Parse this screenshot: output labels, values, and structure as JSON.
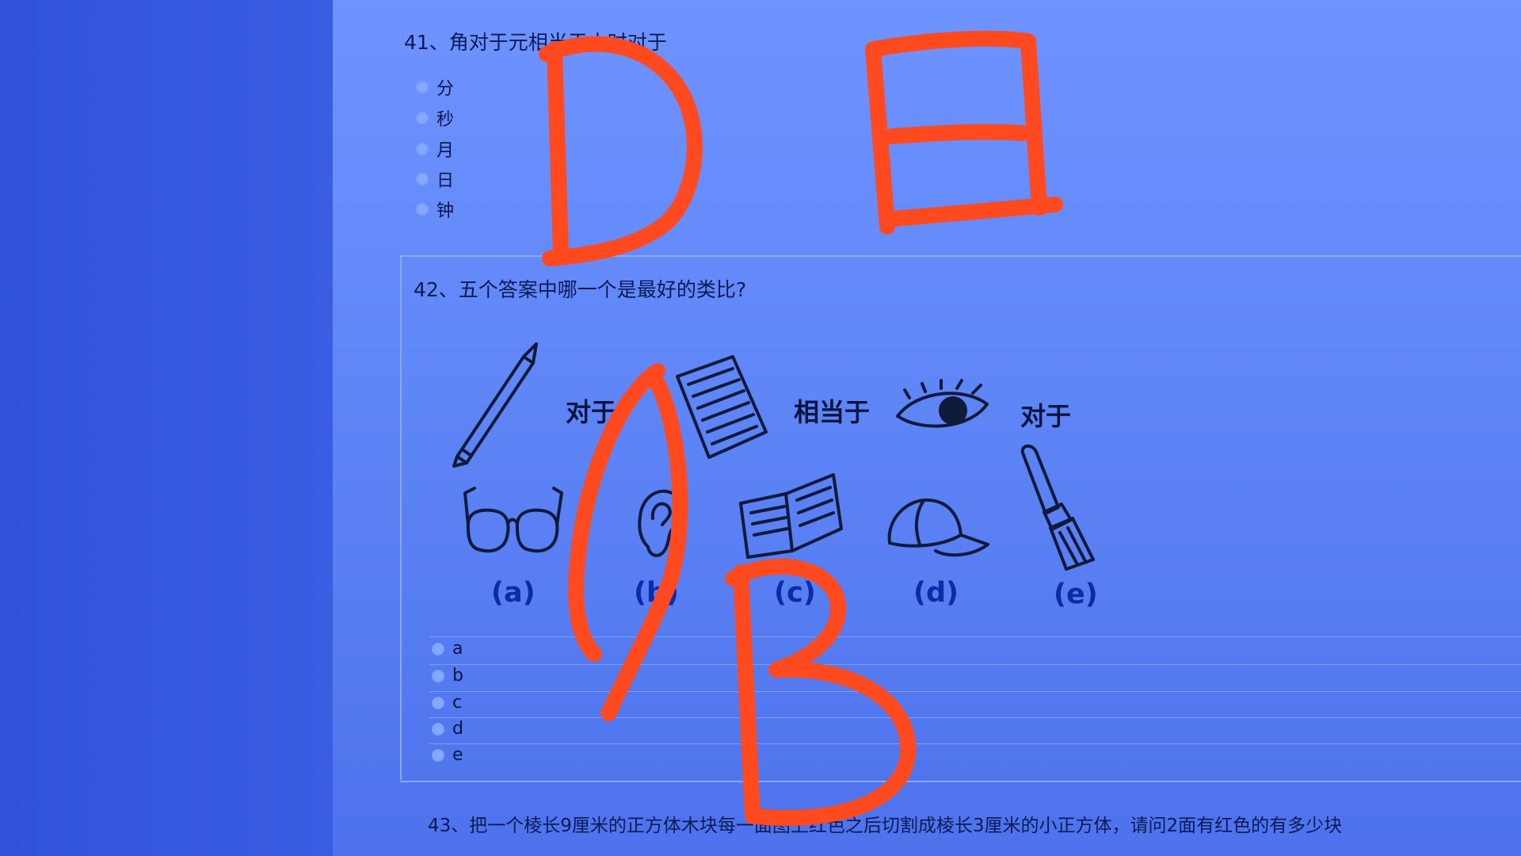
{
  "q41": {
    "title": "41、角对于元相当于小时对于",
    "options": [
      "分",
      "秒",
      "月",
      "日",
      "钟"
    ]
  },
  "q42": {
    "title": "42、五个答案中哪一个是最好的类比?",
    "words": {
      "w1": "对于",
      "w2": "相当于",
      "w3": "对于"
    },
    "figure_labels": [
      "(a)",
      "(b)",
      "(c)",
      "(d)",
      "(e)"
    ],
    "options": [
      "a",
      "b",
      "c",
      "d",
      "e"
    ],
    "icons": [
      "pencil-icon",
      "paper-icon",
      "eye-icon",
      "paintbrush-icon",
      "glasses-icon",
      "ear-icon",
      "book-icon",
      "cap-icon"
    ]
  },
  "q43": {
    "title": "43、把一个棱长9厘米的正方体木块每一面图上红色之后切割成棱长3厘米的小正方体，请问2面有红色的有多少块"
  },
  "handwriting": {
    "color": "#ff4a20",
    "letters": [
      "D",
      "日",
      "B"
    ]
  }
}
